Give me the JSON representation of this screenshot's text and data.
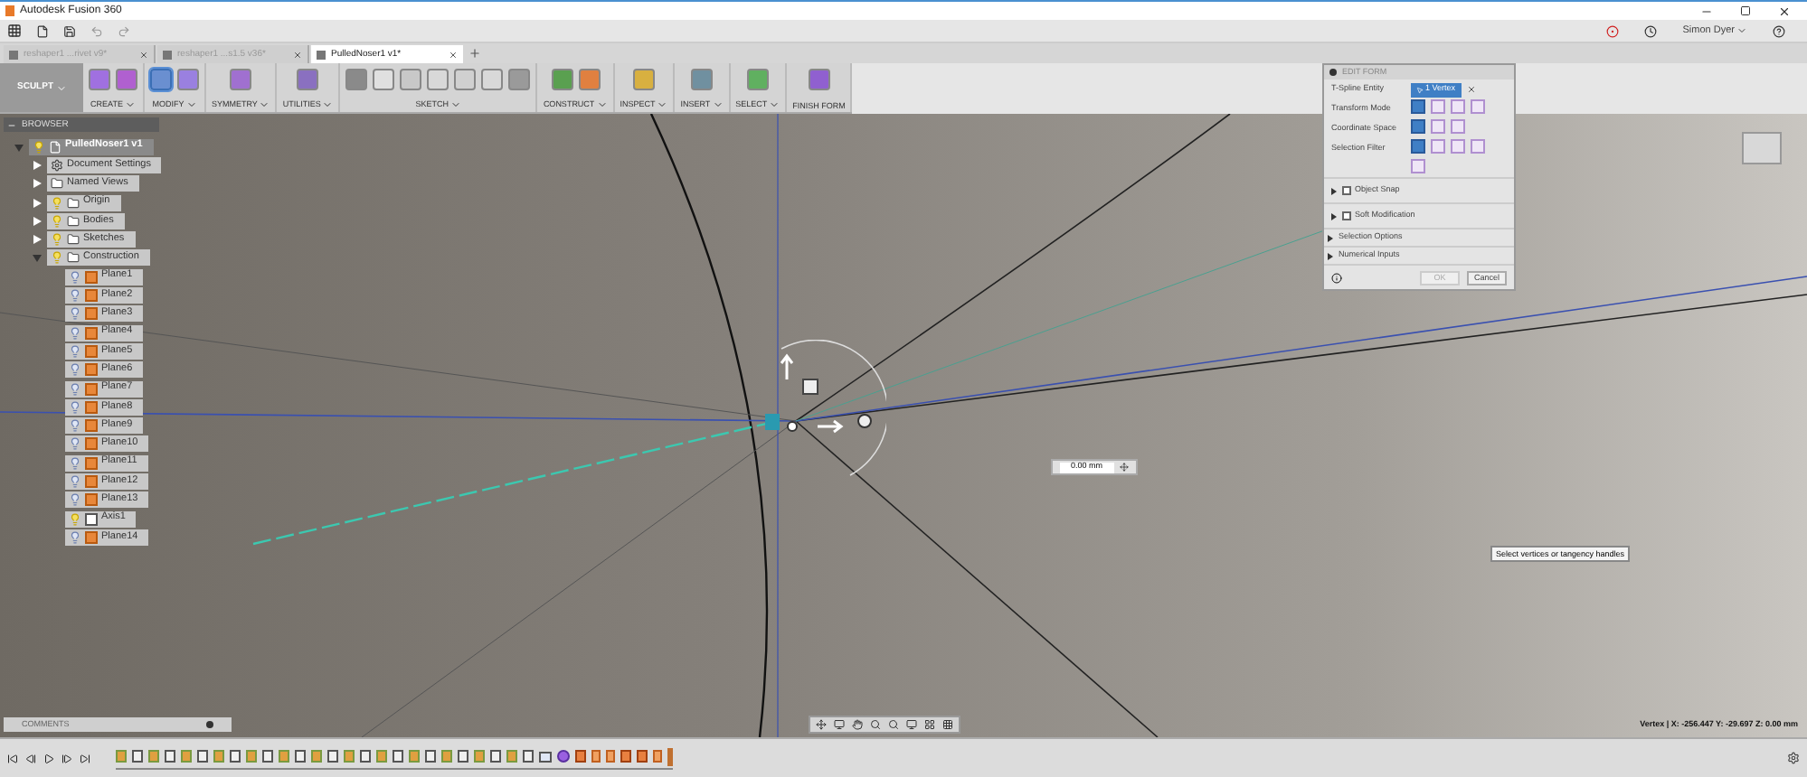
{
  "window": {
    "title": "Autodesk Fusion 360"
  },
  "user": {
    "name": "Simon Dyer"
  },
  "tabs": [
    {
      "label": "reshaper1 ...rivet v9*",
      "selected": false
    },
    {
      "label": "reshaper1 ...s1.5 v36*",
      "selected": false
    },
    {
      "label": "PulledNoser1 v1*",
      "selected": true
    }
  ],
  "ribbon": {
    "workspace": "SCULPT",
    "groups": [
      {
        "label": "CREATE",
        "dropdown": true,
        "tools": [
          {
            "color": "#a070e0",
            "selected": false
          },
          {
            "color": "#b060d0",
            "selected": false
          }
        ]
      },
      {
        "label": "MODIFY",
        "dropdown": true,
        "tools": [
          {
            "color": "#6a8fd0",
            "selected": true
          },
          {
            "color": "#9a80e0",
            "selected": false
          }
        ]
      },
      {
        "label": "SYMMETRY",
        "dropdown": true,
        "tools": [
          {
            "color": "#a070d0",
            "selected": false
          }
        ]
      },
      {
        "label": "UTILITIES",
        "dropdown": true,
        "tools": [
          {
            "color": "#8a70c0",
            "selected": false
          }
        ]
      },
      {
        "label": "SKETCH",
        "dropdown": true,
        "tools": [
          {
            "color": "#8a8a8a",
            "selected": false
          },
          {
            "color": "#e0e0e0",
            "selected": false
          },
          {
            "color": "#c8c8c8",
            "selected": false
          },
          {
            "color": "#d8d8d8",
            "selected": false
          },
          {
            "color": "#d0d0d0",
            "selected": false
          },
          {
            "color": "#d8d8d8",
            "selected": false
          },
          {
            "color": "#9a9a9a",
            "selected": false
          }
        ]
      },
      {
        "label": "CONSTRUCT",
        "dropdown": true,
        "tools": [
          {
            "color": "#5aa050",
            "selected": false
          },
          {
            "color": "#e08040",
            "selected": false
          }
        ]
      },
      {
        "label": "INSPECT",
        "dropdown": true,
        "tools": [
          {
            "color": "#d8b040",
            "selected": false
          }
        ]
      },
      {
        "label": "INSERT",
        "dropdown": true,
        "tools": [
          {
            "color": "#7090a0",
            "selected": false
          }
        ]
      },
      {
        "label": "SELECT",
        "dropdown": true,
        "tools": [
          {
            "color": "#60b060",
            "selected": false
          }
        ]
      },
      {
        "label": "FINISH FORM",
        "dropdown": false,
        "tools": [
          {
            "color": "#9060d0",
            "selected": false
          }
        ]
      }
    ]
  },
  "browser": {
    "title": "BROWSER",
    "tree": [
      {
        "label": "PulledNoser1 v1",
        "kind": "component",
        "visible": true,
        "expanded": true,
        "children": [
          {
            "label": "Document Settings",
            "kind": "settings",
            "expanded": false
          },
          {
            "label": "Named Views",
            "kind": "folder",
            "expanded": false
          },
          {
            "label": "Origin",
            "kind": "folder",
            "visible": true,
            "expanded": false
          },
          {
            "label": "Bodies",
            "kind": "folder",
            "visible": true,
            "expanded": false
          },
          {
            "label": "Sketches",
            "kind": "folder",
            "visible": true,
            "expanded": false
          },
          {
            "label": "Construction",
            "kind": "folder",
            "visible": true,
            "expanded": true,
            "children": [
              {
                "label": "Plane1",
                "kind": "plane",
                "visible": false
              },
              {
                "label": "Plane2",
                "kind": "plane",
                "visible": false
              },
              {
                "label": "Plane3",
                "kind": "plane",
                "visible": false
              },
              {
                "label": "Plane4",
                "kind": "plane",
                "visible": false
              },
              {
                "label": "Plane5",
                "kind": "plane",
                "visible": false
              },
              {
                "label": "Plane6",
                "kind": "plane",
                "visible": false
              },
              {
                "label": "Plane7",
                "kind": "plane",
                "visible": false
              },
              {
                "label": "Plane8",
                "kind": "plane",
                "visible": false
              },
              {
                "label": "Plane9",
                "kind": "plane",
                "visible": false
              },
              {
                "label": "Plane10",
                "kind": "plane",
                "visible": false
              },
              {
                "label": "Plane11",
                "kind": "plane",
                "visible": false
              },
              {
                "label": "Plane12",
                "kind": "plane",
                "visible": false
              },
              {
                "label": "Plane13",
                "kind": "plane",
                "visible": false
              },
              {
                "label": "Axis1",
                "kind": "axis",
                "visible": true
              },
              {
                "label": "Plane14",
                "kind": "plane",
                "visible": false
              }
            ]
          }
        ]
      }
    ]
  },
  "edit_form": {
    "title": "EDIT FORM",
    "entity_label": "T-Spline Entity",
    "entity_value": "1 Vertex",
    "rows": [
      {
        "label": "Transform Mode",
        "options": [
          {
            "selected": true
          },
          {
            "selected": false
          },
          {
            "selected": false
          },
          {
            "selected": false
          }
        ]
      },
      {
        "label": "Coordinate Space",
        "options": [
          {
            "selected": true
          },
          {
            "selected": false
          },
          {
            "selected": false
          }
        ]
      },
      {
        "label": "Selection Filter",
        "options": [
          {
            "selected": true
          },
          {
            "selected": false
          },
          {
            "selected": false
          },
          {
            "selected": false
          },
          {
            "selected": false
          }
        ]
      }
    ],
    "sections": [
      {
        "label": "Object Snap",
        "kind": "checkbox",
        "checked": false
      },
      {
        "label": "Soft Modification",
        "kind": "checkbox",
        "checked": false
      },
      {
        "label": "Selection Options",
        "kind": "plain"
      },
      {
        "label": "Numerical Inputs",
        "kind": "plain"
      }
    ],
    "ok": "OK",
    "cancel": "Cancel"
  },
  "viewport": {
    "dimension": "0.00 mm",
    "tooltip": "Select vertices or tangency handles",
    "status": "Vertex | X: -256.447 Y: -29.697 Z: 0.00 mm"
  },
  "comments": {
    "title": "COMMENTS"
  },
  "timeline": {
    "features": [
      {
        "kind": "plane"
      },
      {
        "kind": "sketch"
      },
      {
        "kind": "plane"
      },
      {
        "kind": "sketch"
      },
      {
        "kind": "plane"
      },
      {
        "kind": "sketch"
      },
      {
        "kind": "plane"
      },
      {
        "kind": "sketch"
      },
      {
        "kind": "plane"
      },
      {
        "kind": "sketch"
      },
      {
        "kind": "plane"
      },
      {
        "kind": "sketch"
      },
      {
        "kind": "plane"
      },
      {
        "kind": "sketch"
      },
      {
        "kind": "plane"
      },
      {
        "kind": "sketch"
      },
      {
        "kind": "plane"
      },
      {
        "kind": "sketch"
      },
      {
        "kind": "plane"
      },
      {
        "kind": "sketch"
      },
      {
        "kind": "plane"
      },
      {
        "kind": "sketch"
      },
      {
        "kind": "plane"
      },
      {
        "kind": "sketch"
      },
      {
        "kind": "plane"
      },
      {
        "kind": "sketch"
      },
      {
        "kind": "view"
      },
      {
        "kind": "form"
      },
      {
        "kind": "body"
      },
      {
        "kind": "mark"
      },
      {
        "kind": "mark"
      },
      {
        "kind": "body"
      },
      {
        "kind": "body"
      },
      {
        "kind": "mark"
      }
    ]
  }
}
